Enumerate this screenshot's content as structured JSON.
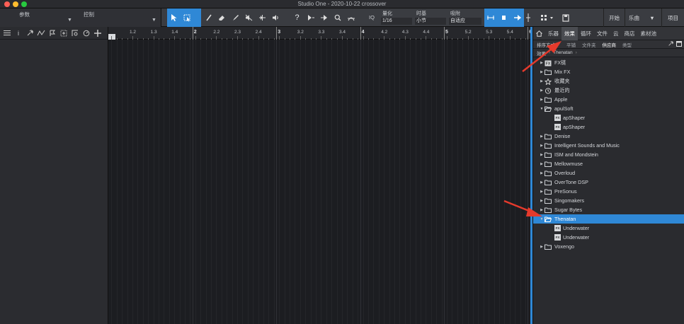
{
  "window": {
    "title": "Studio One - 2020-10-22 crossover"
  },
  "toolbar": {
    "params_label": "参数",
    "control_label": "控制",
    "quantize": {
      "label": "量化",
      "value": "1/16"
    },
    "timebase": {
      "label": "时基",
      "value": "小节"
    },
    "snap": {
      "label": "吸附",
      "value": "自适应"
    },
    "start_label": "开始",
    "song_label": "乐曲",
    "project_label": "项目",
    "iq_label": "IQ"
  },
  "ruler": {
    "labels": [
      "1.2",
      "1.3",
      "1.4",
      "2",
      "2.2",
      "2.3",
      "2.4",
      "3",
      "3.2",
      "3.3",
      "3.4",
      "4",
      "4.2",
      "4.3",
      "4.4",
      "5",
      "5.2",
      "5.3",
      "5.4",
      "6"
    ]
  },
  "browser": {
    "tabs": [
      "乐器",
      "效果",
      "循环",
      "文件",
      "云",
      "商店",
      "素材池"
    ],
    "active_tab": "效果",
    "sort_label": "排序方式",
    "sort_options": [
      "平铺",
      "文件夹",
      "供应商",
      "类型"
    ],
    "active_sort": "供应商",
    "path_root": "效果",
    "path_current": "Thenatan",
    "tree": [
      {
        "label": "FX链",
        "kind": "special",
        "indent": 0
      },
      {
        "label": "Mix FX",
        "kind": "folder",
        "indent": 0
      },
      {
        "label": "收藏夹",
        "kind": "star",
        "indent": 0
      },
      {
        "label": "最近的",
        "kind": "clock",
        "indent": 0
      },
      {
        "label": "Apple",
        "kind": "folder",
        "indent": 0
      },
      {
        "label": "apulSoft",
        "kind": "folder-open",
        "indent": 0
      },
      {
        "label": "apShaper",
        "kind": "plugin",
        "indent": 1
      },
      {
        "label": "apShaper",
        "kind": "plugin",
        "indent": 1
      },
      {
        "label": "Denise",
        "kind": "folder",
        "indent": 0
      },
      {
        "label": "Intelligent Sounds and Music",
        "kind": "folder",
        "indent": 0
      },
      {
        "label": "ISM and Mondstein",
        "kind": "folder",
        "indent": 0
      },
      {
        "label": "Mellowmuse",
        "kind": "folder",
        "indent": 0
      },
      {
        "label": "Overloud",
        "kind": "folder",
        "indent": 0
      },
      {
        "label": "OverTone DSP",
        "kind": "folder",
        "indent": 0
      },
      {
        "label": "PreSonus",
        "kind": "folder",
        "indent": 0
      },
      {
        "label": "Singomakers",
        "kind": "folder",
        "indent": 0
      },
      {
        "label": "Sugar Bytes",
        "kind": "folder",
        "indent": 0
      },
      {
        "label": "Thenatan",
        "kind": "folder-open",
        "indent": 0,
        "selected": true
      },
      {
        "label": "Underwater",
        "kind": "plugin",
        "indent": 1
      },
      {
        "label": "Underwater",
        "kind": "plugin",
        "indent": 1
      },
      {
        "label": "Voxengo",
        "kind": "folder",
        "indent": 0
      }
    ]
  },
  "colors": {
    "accent": "#2f88d6",
    "annotation": "#e53a2c"
  }
}
